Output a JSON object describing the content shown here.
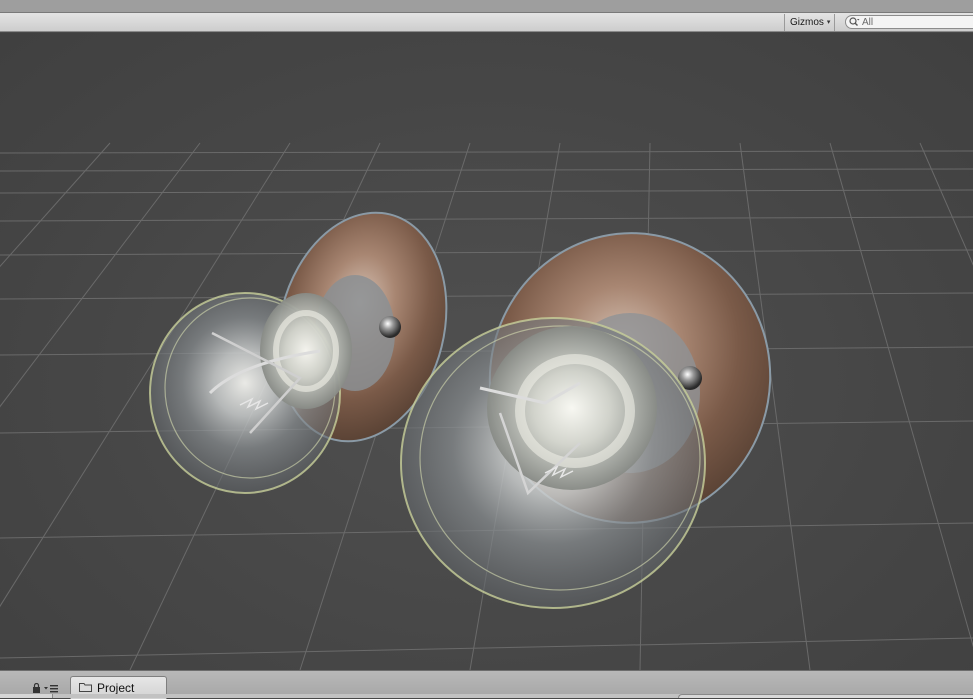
{
  "toolbar": {
    "gizmos_label": "Gizmos",
    "gizmos_caret": "▾",
    "search_placeholder": "All"
  },
  "bottom": {
    "tab_project_label": "Project",
    "icons": [
      "lock-icon",
      "layout-menu-icon",
      "folder-icon"
    ]
  },
  "scene": {
    "objects": [
      "lightbulb-left",
      "lightbulb-right"
    ],
    "grid": true,
    "background_color": "#474747",
    "grid_color": "#6e6e6e"
  }
}
